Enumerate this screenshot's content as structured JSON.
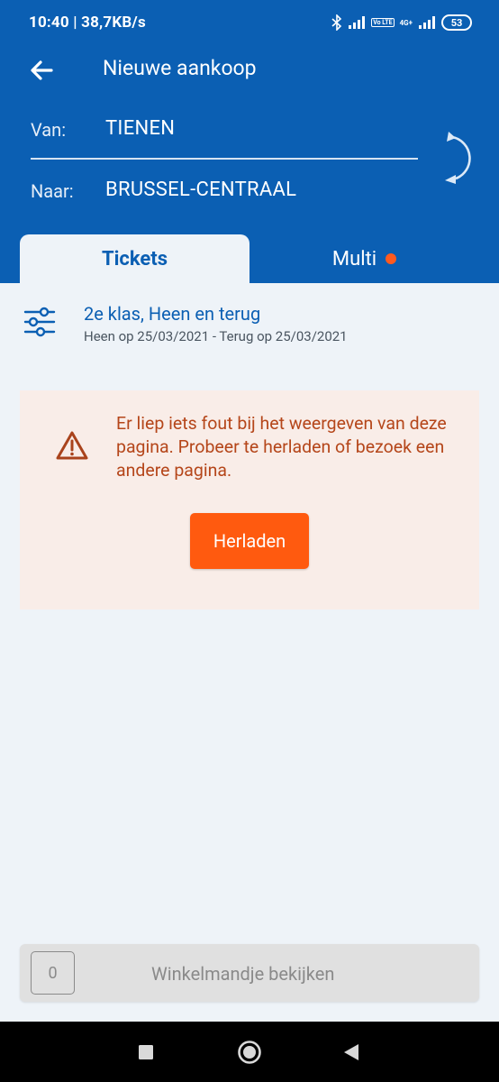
{
  "status_bar": {
    "time_speed": "10:40 | 38,7KB/s",
    "volte_label": "Vo LTE",
    "network_label": "4G+",
    "battery": "53",
    "icons": [
      "bluetooth-icon",
      "signal-icon",
      "volte-icon",
      "signal-4g-icon",
      "battery-icon"
    ]
  },
  "header": {
    "title": "Nieuwe aankoop",
    "from_label": "Van:",
    "from_value": "TIENEN",
    "to_label": "Naar:",
    "to_value": "BRUSSEL-CENTRAAL",
    "icons": [
      "back-arrow-icon",
      "swap-icon"
    ]
  },
  "tabs": [
    {
      "label": "Tickets",
      "active": true
    },
    {
      "label": "Multi",
      "active": false,
      "badge_color": "#ff5a1f"
    }
  ],
  "filter": {
    "title": "2e klas, Heen en terug",
    "subtitle": "Heen op 25/03/2021 - Terug op 25/03/2021",
    "icon": "sliders-icon"
  },
  "error": {
    "message": "Er liep iets fout bij het weergeven van deze pagina. Probeer te herladen of bezoek een andere pagina.",
    "reload_label": "Herladen",
    "icon": "warning-icon"
  },
  "cart": {
    "count": "0",
    "label": "Winkelmandje bekijken"
  },
  "colors": {
    "primary": "#0b5fb3",
    "accent": "#ff5a0f",
    "error_text": "#b5461a",
    "error_bg": "#f9ede8",
    "page_bg": "#eef3f8"
  }
}
